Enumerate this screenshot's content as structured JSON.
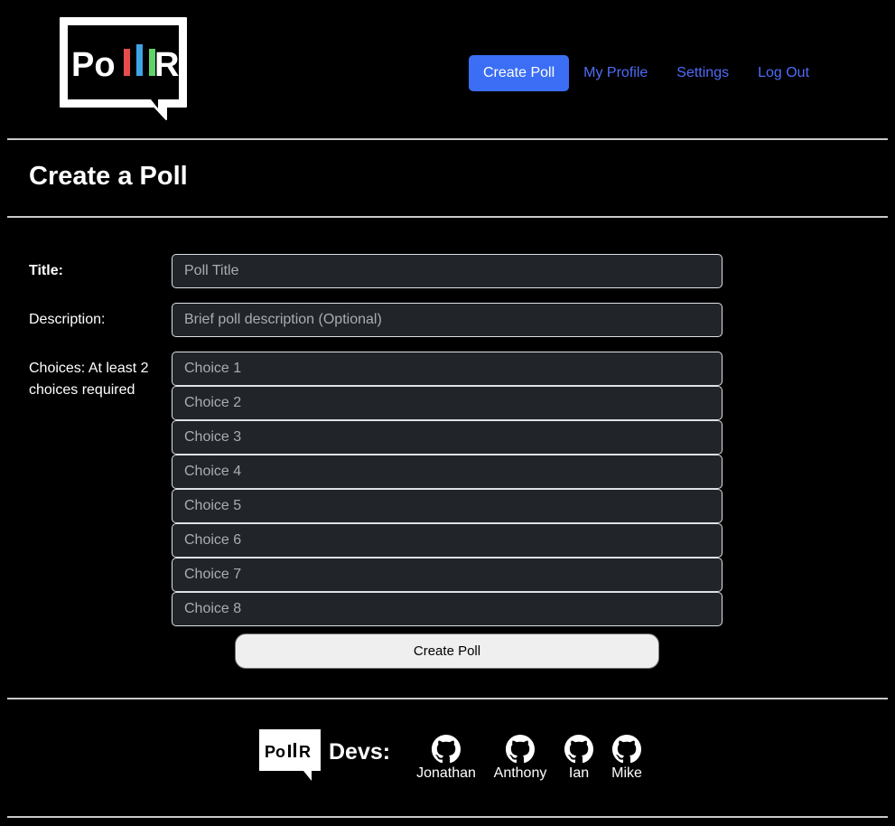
{
  "header": {
    "logo_text": "PollR",
    "nav": {
      "create_poll": "Create Poll",
      "my_profile": "My Profile",
      "settings": "Settings",
      "log_out": "Log Out"
    }
  },
  "page_title": "Create a Poll",
  "form": {
    "title_label": "Title:",
    "title_placeholder": "Poll Title",
    "title_value": "",
    "description_label": "Description:",
    "description_placeholder": "Brief poll description (Optional)",
    "description_value": "",
    "choices_label_line1": "Choices: At least 2",
    "choices_label_line2": "choices required",
    "choices": [
      {
        "placeholder": "Choice 1",
        "value": ""
      },
      {
        "placeholder": "Choice 2",
        "value": ""
      },
      {
        "placeholder": "Choice 3",
        "value": ""
      },
      {
        "placeholder": "Choice 4",
        "value": ""
      },
      {
        "placeholder": "Choice 5",
        "value": ""
      },
      {
        "placeholder": "Choice 6",
        "value": ""
      },
      {
        "placeholder": "Choice 7",
        "value": ""
      },
      {
        "placeholder": "Choice 8",
        "value": ""
      }
    ],
    "submit_label": "Create Poll"
  },
  "footer": {
    "logo_text": "PollR",
    "devs_label": "Devs:",
    "devs": [
      {
        "name": "Jonathan",
        "icon": "github-icon"
      },
      {
        "name": "Anthony",
        "icon": "github-icon"
      },
      {
        "name": "Ian",
        "icon": "github-icon"
      },
      {
        "name": "Mike",
        "icon": "github-icon"
      }
    ]
  },
  "colors": {
    "background": "#000000",
    "accent": "#3b6ef5",
    "link": "#4f6cf7",
    "logo_bar_red": "#e74c4c",
    "logo_bar_blue": "#3da4e6",
    "logo_bar_green": "#5fd36a"
  }
}
